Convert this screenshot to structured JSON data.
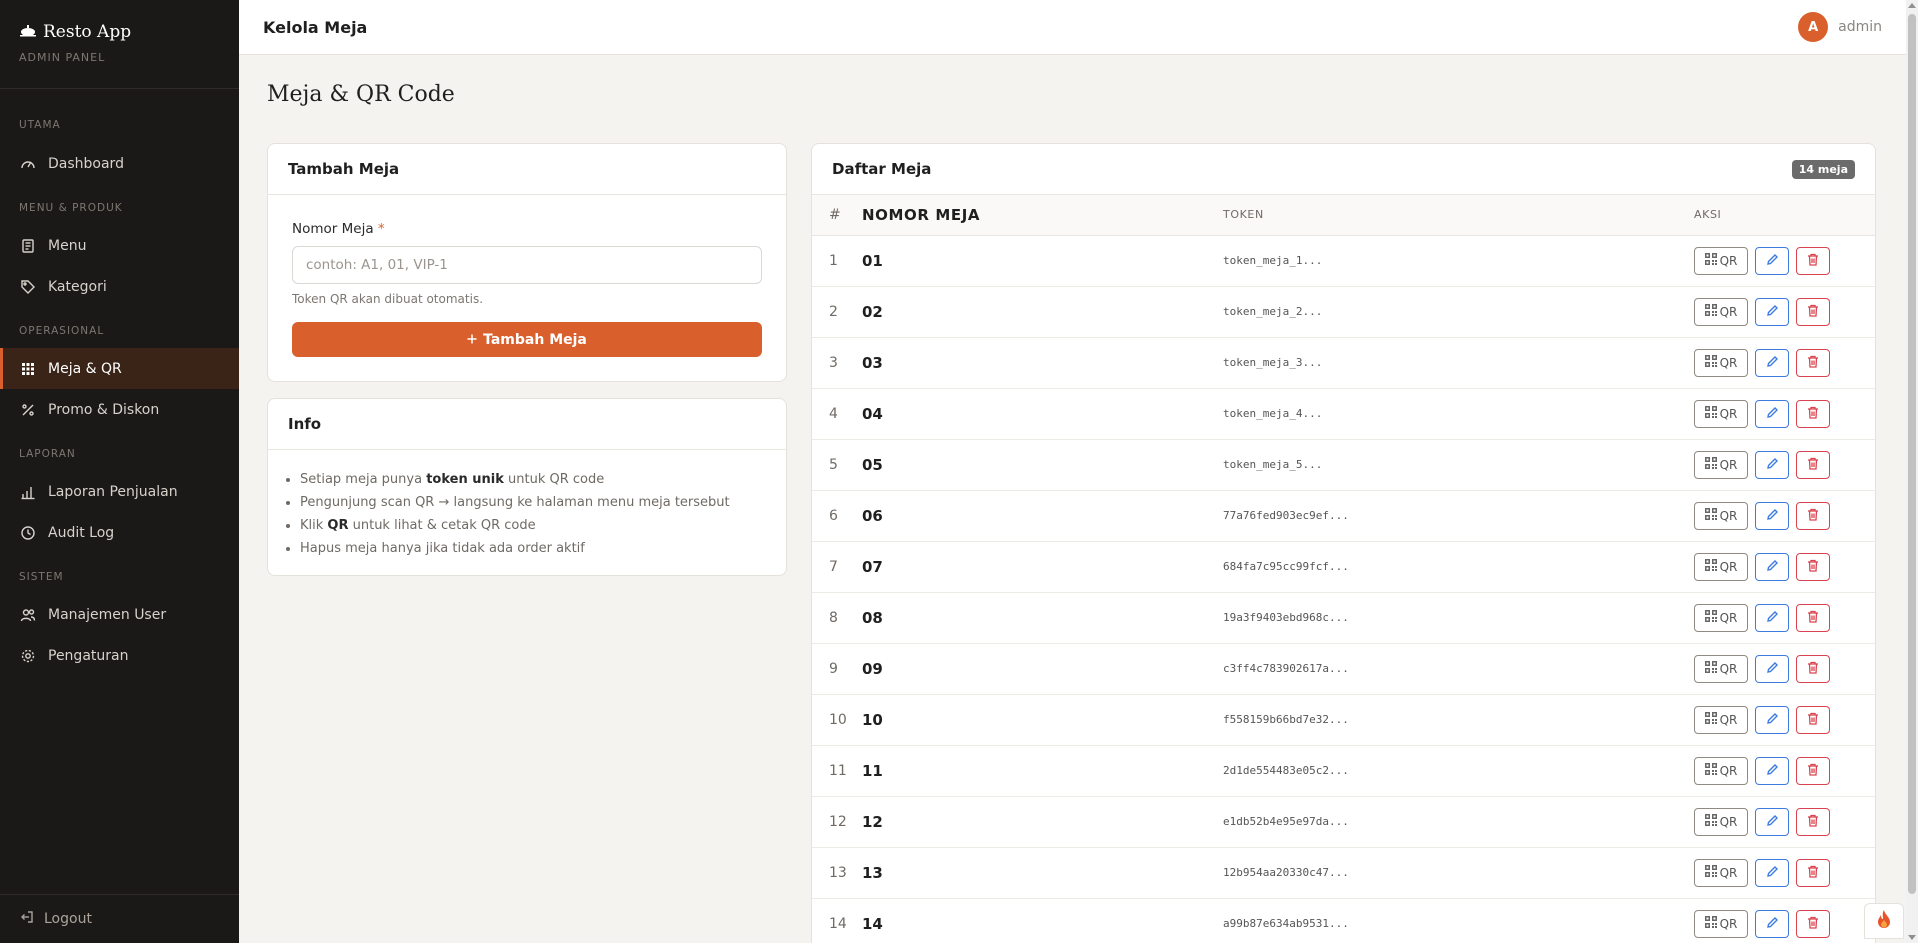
{
  "sidebar": {
    "brand_title": "Resto App",
    "brand_sub": "ADMIN PANEL",
    "sections": {
      "utama": "UTAMA",
      "menu_produk": "MENU & PRODUK",
      "operasional": "OPERASIONAL",
      "laporan": "LAPORAN",
      "sistem": "SISTEM"
    },
    "items": {
      "dashboard": "Dashboard",
      "menu": "Menu",
      "kategori": "Kategori",
      "meja_qr": "Meja & QR",
      "promo": "Promo & Diskon",
      "laporan_penjualan": "Laporan Penjualan",
      "audit_log": "Audit Log",
      "manajemen_user": "Manajemen User",
      "pengaturan": "Pengaturan"
    },
    "active": "meja_qr",
    "logout": "Logout"
  },
  "topbar": {
    "title": "Kelola Meja",
    "avatar_initial": "A",
    "user_name": "admin"
  },
  "page_title": "Meja & QR Code",
  "add_form": {
    "title": "Tambah Meja",
    "field_label": "Nomor Meja",
    "required_mark": "*",
    "placeholder": "contoh: A1, 01, VIP-1",
    "value": "",
    "hint": "Token QR akan dibuat otomatis.",
    "button_label": "Tambah Meja"
  },
  "info": {
    "title": "Info",
    "items": [
      {
        "pre": "Setiap meja punya ",
        "bold": "token unik",
        "post": " untuk QR code"
      },
      {
        "pre": "Pengunjung scan QR → langsung ke halaman menu meja tersebut",
        "bold": "",
        "post": ""
      },
      {
        "pre": "Klik ",
        "bold": "QR",
        "post": " untuk lihat & cetak QR code"
      },
      {
        "pre": "Hapus meja hanya jika tidak ada order aktif",
        "bold": "",
        "post": ""
      }
    ]
  },
  "table": {
    "title": "Daftar Meja",
    "count_badge": "14 meja",
    "columns": {
      "num": "#",
      "nomor": "NOMOR MEJA",
      "token": "TOKEN",
      "aksi": "AKSI"
    },
    "qr_label": "QR",
    "rows": [
      {
        "num": "1",
        "nomor": "01",
        "token": "token_meja_1..."
      },
      {
        "num": "2",
        "nomor": "02",
        "token": "token_meja_2..."
      },
      {
        "num": "3",
        "nomor": "03",
        "token": "token_meja_3..."
      },
      {
        "num": "4",
        "nomor": "04",
        "token": "token_meja_4..."
      },
      {
        "num": "5",
        "nomor": "05",
        "token": "token_meja_5..."
      },
      {
        "num": "6",
        "nomor": "06",
        "token": "77a76fed903ec9ef..."
      },
      {
        "num": "7",
        "nomor": "07",
        "token": "684fa7c95cc99fcf..."
      },
      {
        "num": "8",
        "nomor": "08",
        "token": "19a3f9403ebd968c..."
      },
      {
        "num": "9",
        "nomor": "09",
        "token": "c3ff4c783902617a..."
      },
      {
        "num": "10",
        "nomor": "10",
        "token": "f558159b66bd7e32..."
      },
      {
        "num": "11",
        "nomor": "11",
        "token": "2d1de554483e05c2..."
      },
      {
        "num": "12",
        "nomor": "12",
        "token": "e1db52b4e95e97da..."
      },
      {
        "num": "13",
        "nomor": "13",
        "token": "12b954aa20330c47..."
      },
      {
        "num": "14",
        "nomor": "14",
        "token": "a99b87e634ab9531..."
      }
    ]
  },
  "colors": {
    "accent": "#d9602c",
    "sidebar_bg": "#1b1917",
    "edit": "#3d7be0",
    "delete": "#d9434f"
  },
  "icons": {
    "brand": "plate-icon",
    "dashboard": "gauge-icon",
    "menu": "book-icon",
    "kategori": "tag-icon",
    "meja_qr": "grid-icon",
    "promo": "percent-icon",
    "laporan": "bar-chart-icon",
    "audit": "clock-icon",
    "user": "users-icon",
    "pengaturan": "gear-icon",
    "logout": "logout-icon",
    "qr": "qr-icon",
    "edit": "pencil-icon",
    "delete": "trash-icon",
    "fire": "fire-icon"
  }
}
